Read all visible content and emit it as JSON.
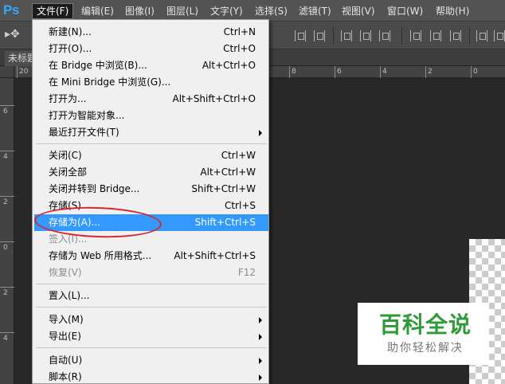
{
  "app": {
    "logo": "Ps"
  },
  "menubar": [
    {
      "label": "文件(F)",
      "active": true
    },
    {
      "label": "编辑(E)"
    },
    {
      "label": "图像(I)"
    },
    {
      "label": "图层(L)"
    },
    {
      "label": "文字(Y)"
    },
    {
      "label": "选择(S)"
    },
    {
      "label": "滤镜(T)"
    },
    {
      "label": "视图(V)"
    },
    {
      "label": "窗口(W)"
    },
    {
      "label": "帮助(H)"
    }
  ],
  "document_tab": {
    "label": "未标题"
  },
  "ruler_top": [
    "20",
    "8",
    "6",
    "4",
    "2",
    "0"
  ],
  "ruler_left": [
    "6",
    "4",
    "2",
    "0",
    "2",
    "4"
  ],
  "file_menu": [
    {
      "label": "新建(N)...",
      "shortcut": "Ctrl+N"
    },
    {
      "label": "打开(O)...",
      "shortcut": "Ctrl+O"
    },
    {
      "label": "在 Bridge 中浏览(B)...",
      "shortcut": "Alt+Ctrl+O"
    },
    {
      "label": "在 Mini Bridge 中浏览(G)...",
      "shortcut": ""
    },
    {
      "label": "打开为...",
      "shortcut": "Alt+Shift+Ctrl+O"
    },
    {
      "label": "打开为智能对象...",
      "shortcut": ""
    },
    {
      "label": "最近打开文件(T)",
      "shortcut": "",
      "submenu": true
    },
    {
      "label": "关闭(C)",
      "shortcut": "Ctrl+W"
    },
    {
      "label": "关闭全部",
      "shortcut": "Alt+Ctrl+W"
    },
    {
      "label": "关闭并转到 Bridge...",
      "shortcut": "Shift+Ctrl+W"
    },
    {
      "label": "存储(S)",
      "shortcut": "Ctrl+S"
    },
    {
      "label": "存储为(A)...",
      "shortcut": "Shift+Ctrl+S",
      "highlighted": true
    },
    {
      "label": "签入(I)...",
      "shortcut": "",
      "disabled": true
    },
    {
      "label": "存储为 Web 所用格式...",
      "shortcut": "Alt+Shift+Ctrl+S"
    },
    {
      "label": "恢复(V)",
      "shortcut": "F12",
      "disabled": true
    },
    {
      "label": "置入(L)...",
      "shortcut": ""
    },
    {
      "label": "导入(M)",
      "shortcut": "",
      "submenu": true
    },
    {
      "label": "导出(E)",
      "shortcut": "",
      "submenu": true
    },
    {
      "label": "自动(U)",
      "shortcut": "",
      "submenu": true
    },
    {
      "label": "脚本(R)",
      "shortcut": "",
      "submenu": true
    }
  ],
  "watermark": {
    "title": "百科全说",
    "subtitle": "助你轻松解决"
  },
  "colors": {
    "highlight": "#3399ff",
    "annotation": "#d6262f",
    "watermark_green": "#2e9a3a"
  }
}
